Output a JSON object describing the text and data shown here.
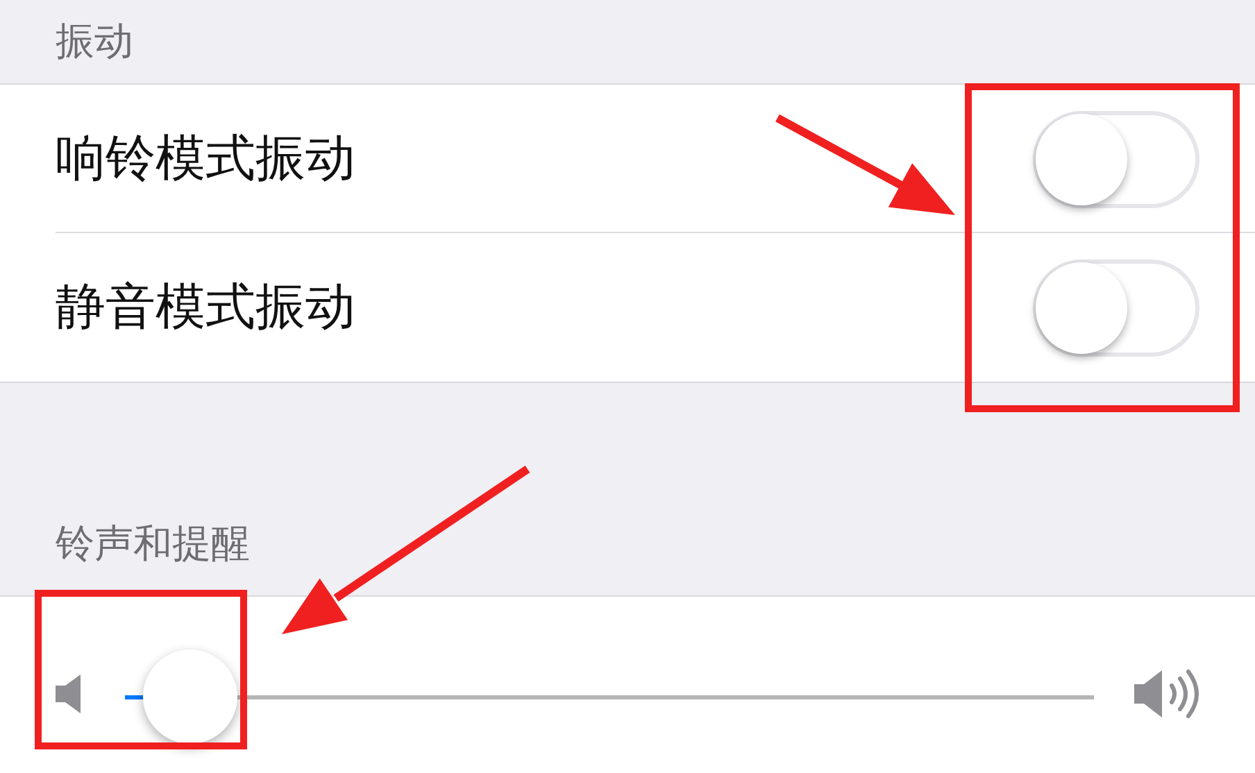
{
  "vibration": {
    "header": "振动",
    "rows": [
      {
        "label": "响铃模式振动",
        "on": false
      },
      {
        "label": "静音模式振动",
        "on": false
      }
    ]
  },
  "ringer": {
    "header": "铃声和提醒",
    "slider": {
      "level": 0.02
    }
  }
}
